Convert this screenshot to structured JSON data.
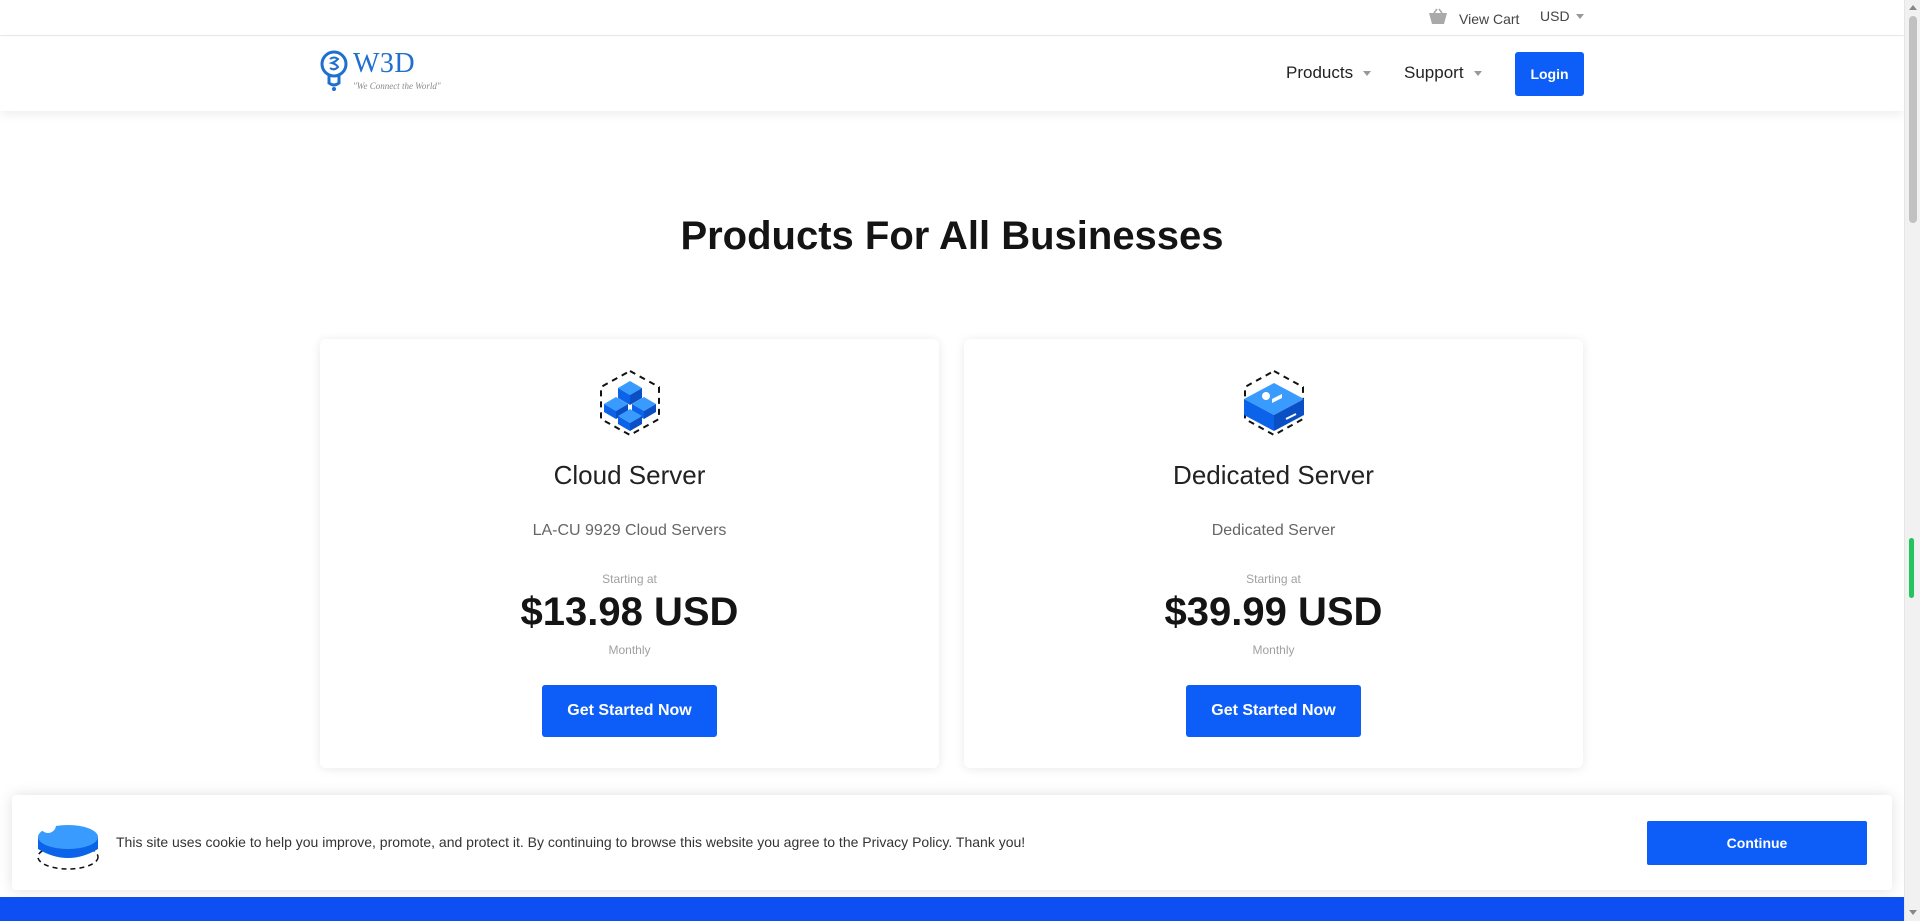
{
  "topbar": {
    "cart_label": "View Cart",
    "currency_label": "USD"
  },
  "header": {
    "logo": {
      "wordmark": "W3D",
      "tagline": "\"We Connect the World\""
    },
    "nav": [
      {
        "label": "Products"
      },
      {
        "label": "Support"
      }
    ],
    "login_label": "Login"
  },
  "main": {
    "title": "Products For All Businesses",
    "cards": [
      {
        "name": "Cloud Server",
        "description": "LA-CU 9929 Cloud Servers",
        "starting_label": "Starting at",
        "price": "$13.98 USD",
        "cycle": "Monthly",
        "cta_label": "Get Started Now",
        "icon": "cubes-icon"
      },
      {
        "name": "Dedicated Server",
        "description": "Dedicated Server",
        "starting_label": "Starting at",
        "price": "$39.99 USD",
        "cycle": "Monthly",
        "cta_label": "Get Started Now",
        "icon": "server-box-icon"
      }
    ]
  },
  "cookie_bar": {
    "message": "This site uses cookie to help you improve, promote, and protect it. By continuing to browse this website you agree to the Privacy Policy. Thank you!",
    "continue_label": "Continue"
  },
  "colors": {
    "primary": "#0d5ef8",
    "logo_blue": "#1f6fcf",
    "footer_blue": "#0d4ff2",
    "scroll_indicator": "#22c55e"
  }
}
